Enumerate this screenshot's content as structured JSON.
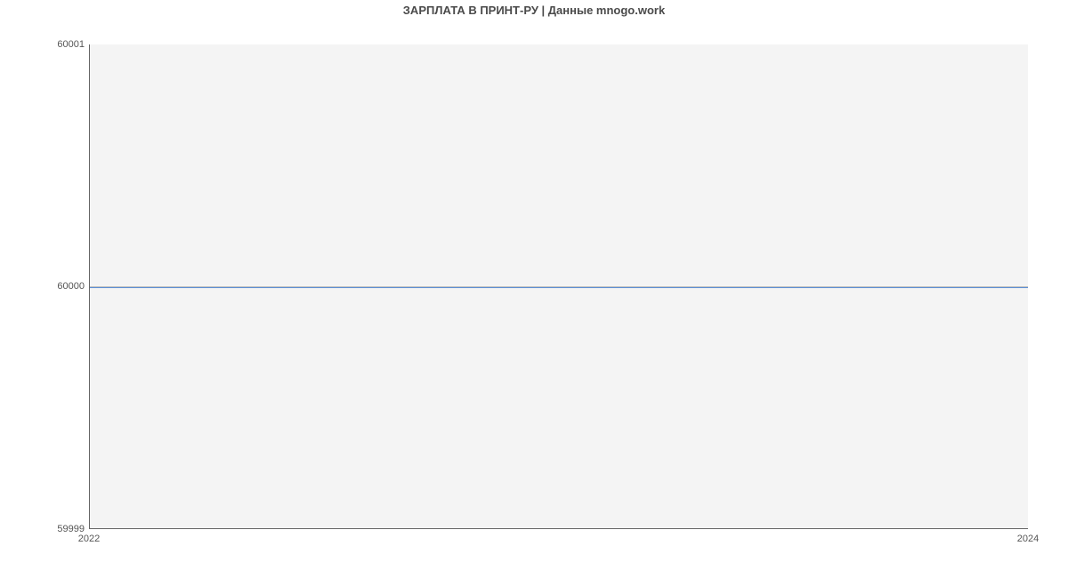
{
  "chart_data": {
    "type": "line",
    "title": "ЗАРПЛАТА В ПРИНТ-РУ | Данные mnogo.work",
    "x": [
      2022,
      2024
    ],
    "values": [
      60000,
      60000
    ],
    "xlabel": "",
    "ylabel": "",
    "xticks": [
      2022,
      2024
    ],
    "yticks": [
      59999,
      60000,
      60001
    ],
    "xlim": [
      2022,
      2024
    ],
    "ylim": [
      59999,
      60001
    ],
    "colors": {
      "line": "#5b8fd6",
      "plot_bg": "#f4f4f4"
    }
  }
}
